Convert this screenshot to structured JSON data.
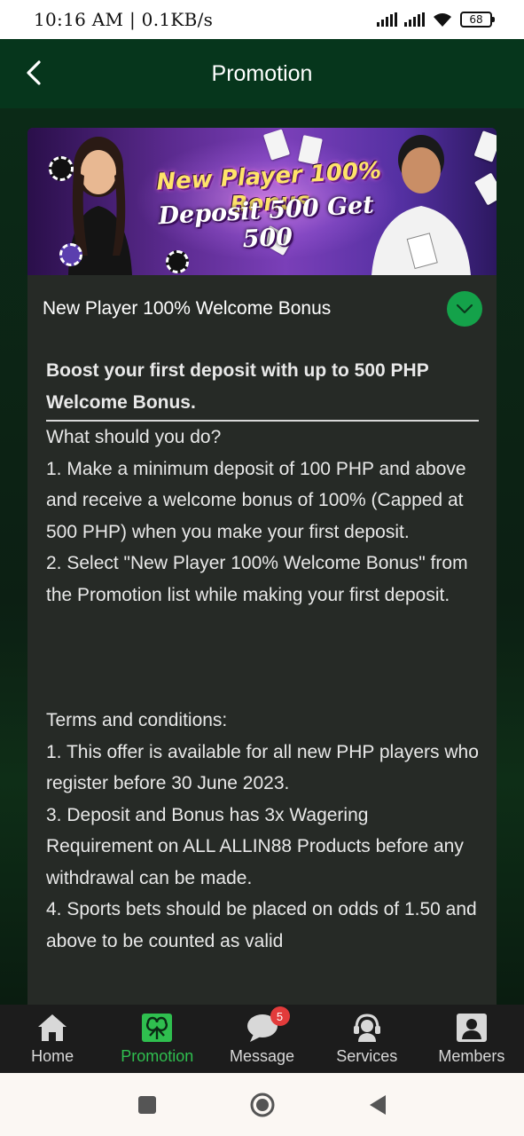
{
  "status_bar": {
    "time_speed": "10:16 AM | 0.1KB/s",
    "battery": "68"
  },
  "header": {
    "title": "Promotion",
    "back_icon": "chevron-left-icon"
  },
  "promo": {
    "banner": {
      "line1": "New Player 100% Bonus",
      "line2": "Deposit 500 Get 500"
    },
    "title": "New Player 100% Welcome Bonus",
    "lead": "Boost your first deposit with up to 500 PHP Welcome Bonus.",
    "paragraphs_a": [
      "What should you do?",
      "1. Make a minimum deposit of 100 PHP and above and receive a welcome bonus of 100% (Capped at 500 PHP) when you make your first deposit.",
      "2. Select \"New Player 100% Welcome Bonus\" from the Promotion list while making your first deposit."
    ],
    "paragraphs_b": [
      "Terms and conditions:",
      "1. This offer is available for all new PHP players who register before 30 June 2023.",
      "3. Deposit and Bonus has 3x Wagering Requirement on ALL ALLIN88 Products before any withdrawal can be made.",
      "4. Sports bets should be placed on odds of 1.50 and above to be counted as valid"
    ]
  },
  "bottom_nav": {
    "items": [
      {
        "label": "Home",
        "icon": "home-icon"
      },
      {
        "label": "Promotion",
        "icon": "promotion-icon",
        "active": true
      },
      {
        "label": "Message",
        "icon": "message-icon",
        "badge": "5"
      },
      {
        "label": "Services",
        "icon": "headset-icon"
      },
      {
        "label": "Members",
        "icon": "member-icon"
      }
    ]
  },
  "colors": {
    "header_bg": "#06361c",
    "accent_green": "#14a24a",
    "active_nav": "#2fbf4f",
    "badge_red": "#e23b3b",
    "card_bg": "#262a26"
  }
}
